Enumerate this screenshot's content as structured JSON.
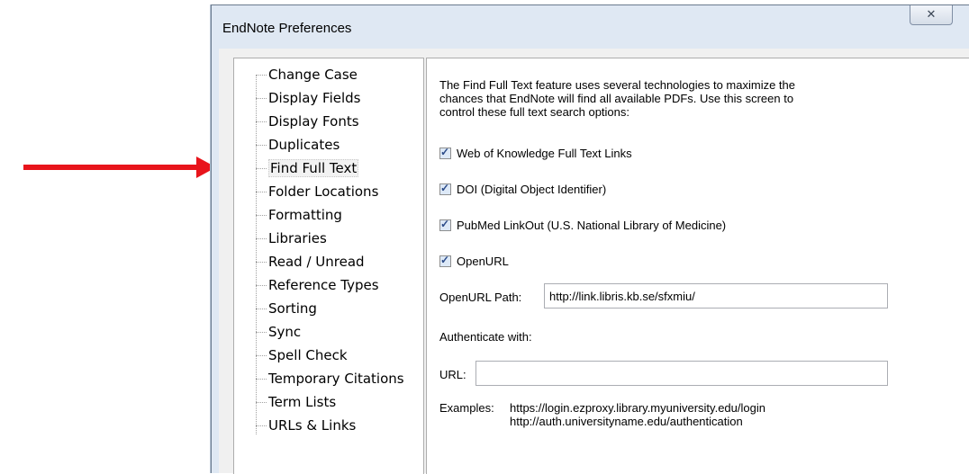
{
  "window": {
    "title": "EndNote Preferences",
    "close_symbol": "✕"
  },
  "tree": {
    "items": [
      {
        "label": "Change Case"
      },
      {
        "label": "Display Fields"
      },
      {
        "label": "Display Fonts"
      },
      {
        "label": "Duplicates"
      },
      {
        "label": "Find Full Text"
      },
      {
        "label": "Folder Locations"
      },
      {
        "label": "Formatting"
      },
      {
        "label": "Libraries"
      },
      {
        "label": "Read / Unread"
      },
      {
        "label": "Reference Types"
      },
      {
        "label": "Sorting"
      },
      {
        "label": "Sync"
      },
      {
        "label": "Spell Check"
      },
      {
        "label": "Temporary Citations"
      },
      {
        "label": "Term Lists"
      },
      {
        "label": "URLs & Links"
      }
    ],
    "selected": "Find Full Text"
  },
  "panel": {
    "description_lines": [
      "The Find Full Text feature uses several technologies to maximize the",
      "chances that EndNote will find all available PDFs. Use this screen to",
      "control these full text search options:"
    ],
    "options": [
      {
        "label": "Web of Knowledge Full Text Links",
        "checked": true
      },
      {
        "label": "DOI (Digital Object Identifier)",
        "checked": true
      },
      {
        "label": "PubMed LinkOut (U.S. National Library of Medicine)",
        "checked": true
      },
      {
        "label": "OpenURL",
        "checked": true
      }
    ],
    "openurl_path_label": "OpenURL Path:",
    "openurl_path_value": "http://link.libris.kb.se/sfxmiu/",
    "authenticate_label": "Authenticate with:",
    "url_label": "URL:",
    "url_value": "",
    "examples_label": "Examples:",
    "examples": [
      "https://login.ezproxy.library.myuniversity.edu/login",
      "http://auth.universityname.edu/authentication"
    ]
  },
  "colors": {
    "annotation_arrow": "#e8141b",
    "window_frame": "#dfe8f3"
  }
}
